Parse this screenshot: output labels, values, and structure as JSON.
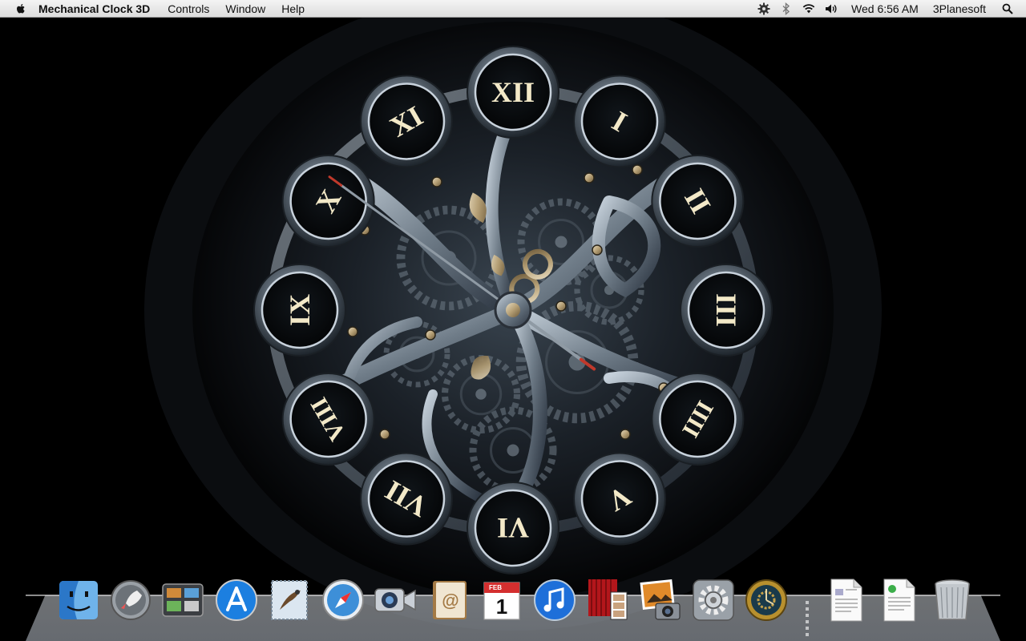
{
  "menubar": {
    "apple_icon": "apple-icon",
    "app_name": "Mechanical Clock 3D",
    "menus": [
      "Controls",
      "Window",
      "Help"
    ],
    "status_icons": [
      "gear-icon",
      "bluetooth-icon",
      "wifi-icon",
      "volume-icon"
    ],
    "clock": "Wed 6:56 AM",
    "user": "3Planesoft",
    "spotlight_icon": "spotlight-icon"
  },
  "clock_face": {
    "numerals": [
      "XII",
      "I",
      "II",
      "III",
      "IIII",
      "V",
      "VI",
      "VII",
      "VIII",
      "IX",
      "X",
      "XI"
    ],
    "time": {
      "hour": 6,
      "minute": 56,
      "second": 51
    },
    "colors": {
      "background": "#000000",
      "metal": "#7f8c99",
      "numeral": "#f3e9c8",
      "hand": "#c9b48a",
      "second_hand": "#c0392b"
    }
  },
  "dock": {
    "apps": [
      {
        "name": "Finder",
        "icon": "finder-icon"
      },
      {
        "name": "Launchpad",
        "icon": "launchpad-icon"
      },
      {
        "name": "Mission Control",
        "icon": "mission-control-icon"
      },
      {
        "name": "App Store",
        "icon": "app-store-icon"
      },
      {
        "name": "Mail",
        "icon": "mail-icon"
      },
      {
        "name": "Safari",
        "icon": "safari-icon"
      },
      {
        "name": "FaceTime",
        "icon": "facetime-icon"
      },
      {
        "name": "Address Book",
        "icon": "address-book-icon"
      },
      {
        "name": "iCal",
        "icon": "calendar-icon",
        "month": "FEB",
        "day": "1"
      },
      {
        "name": "iTunes",
        "icon": "itunes-icon"
      },
      {
        "name": "Photo Booth",
        "icon": "photo-booth-icon"
      },
      {
        "name": "iPhoto",
        "icon": "iphoto-icon"
      },
      {
        "name": "System Preferences",
        "icon": "system-preferences-icon"
      },
      {
        "name": "Mechanical Clock 3D",
        "icon": "mechanical-clock-icon"
      }
    ],
    "documents": [
      {
        "name": "Document",
        "icon": "document-icon"
      },
      {
        "name": "Installer Document",
        "icon": "installer-document-icon"
      }
    ],
    "trash": {
      "name": "Trash",
      "icon": "trash-icon"
    }
  }
}
